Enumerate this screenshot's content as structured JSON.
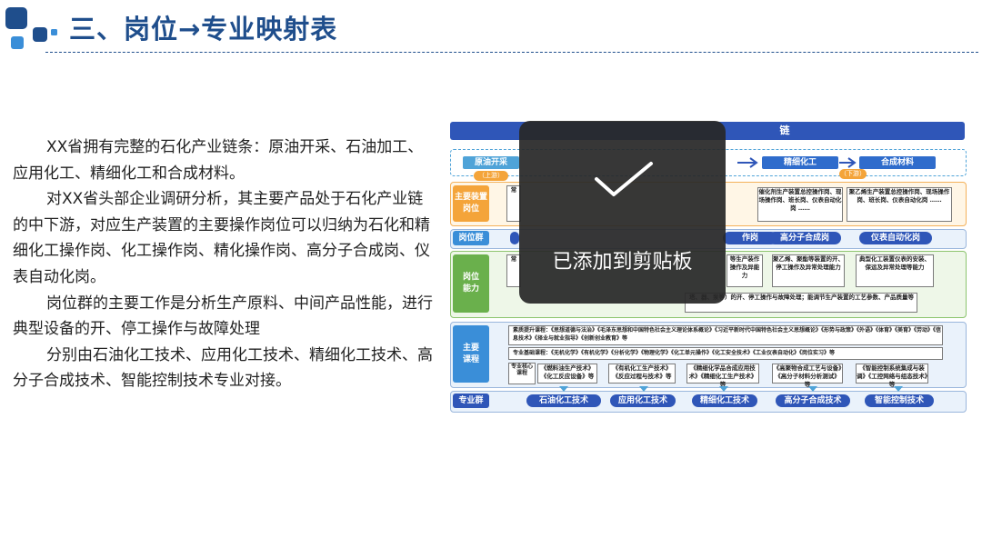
{
  "slide": {
    "title": "三、岗位→专业映射表",
    "paragraphs": [
      "XX省拥有完整的石化产业链条：原油开采、石油加工、应用化工、精细化工和合成材料。",
      "对XX省头部企业调研分析，其主要产品处于石化产业链的中下游，对应生产装置的主要操作岗位可以归纳为石化和精细化工操作岗、化工操作岗、精化操作岗、高分子合成岗、仪表自动化岗。",
      "岗位群的主要工作是分析生产原料、中间产品性能，进行典型设备的开、停工操作与故障处理",
      "分别由石油化工技术、应用化工技术、精细化工技术、高分子合成技术、智能控制技术专业对接。"
    ]
  },
  "diagram": {
    "header": "链",
    "chain": [
      "原油开采",
      "精细化工",
      "合成材料"
    ],
    "upstream": "（上游）",
    "downstream": "（下游）",
    "rows": {
      "devices_label": "主要装置岗位",
      "group_label": "岗位群",
      "ability_label": "岗位能力",
      "courses_label": "主要课程",
      "major_label": "专业群"
    },
    "devices": [
      "常",
      "催化剂生产装置总控操作岗、现场操作岗、班长岗、仪表自动化岗 ……",
      "聚乙烯生产装置总控操作岗、现场操作岗、班长岗、仪表自动化岗 ……"
    ],
    "groups": [
      "作岗",
      "高分子合成岗",
      "仪表自动化岗"
    ],
    "abilities": [
      "常",
      "等生产装作操作及异能力",
      "聚乙烯、聚酯等装置的开、停工操作及异常处理能力",
      "典型化工装置仪表的安装、保运及异常处理等能力"
    ],
    "ability_bar": "塔、器、泵等）的开、停工操作与故障处理；能调节生产装置的工艺参数、产品质量等",
    "courses": {
      "quality": "素质提升课程：《思想道德与法治》《毛泽东思想和中国特色社会主义理论体系概论》《习近平新时代中国特色社会主义思想概论》《形势与政策》《外语》《体育》《美育》《劳动》《信息技术》《择业与就业指导》《创新创业教育》等",
      "basic": "专业基础课程：《无机化学》《有机化学》《分析化学》《物理化学》《化工单元操作》《化工安全技术》《工业仪表自动化》《岗位实习》等",
      "core_label": "专业核心课程",
      "core": [
        "《燃料油生产技术》《化工反应设备》等",
        "《有机化工生产技术》《反应过程与技术》等",
        "《精细化学品合成应用技术》《精细化工生产技术》等",
        "《高聚物合成工艺与设备》《高分子材料分析测试》等",
        "《智能控制系统集成与装调》《工控网络与组态技术》等"
      ]
    },
    "majors": [
      "石油化工技术",
      "应用化工技术",
      "精细化工技术",
      "高分子合成技术",
      "智能控制技术"
    ]
  },
  "toast": {
    "message": "已添加到剪贴板",
    "icon": "check-icon"
  },
  "colors": {
    "title": "#1f4e8c",
    "accent": "#2f56b8",
    "orange": "#f4a43a",
    "green": "#6ab04c",
    "blue_label": "#3a8ed8"
  }
}
